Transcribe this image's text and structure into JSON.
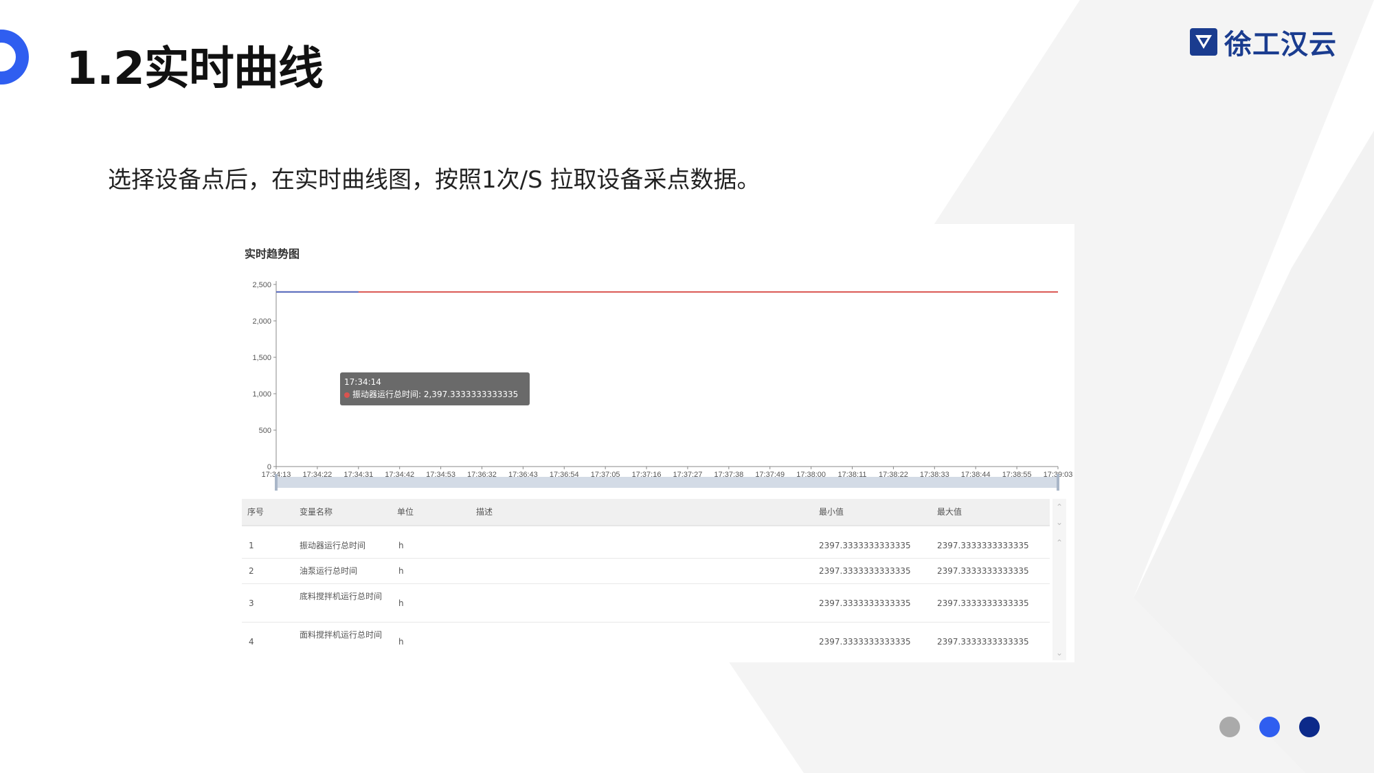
{
  "slide": {
    "title": "1.2实时曲线",
    "subtitle": "选择设备点后，在实时曲线图，按照1次/S 拉取设备采点数据。",
    "logo_text": "徐工汉云"
  },
  "colors": {
    "accent": "#2f5ef0",
    "logo": "#1a3c8f",
    "dot_gray": "#aaaaaa",
    "dot_blue": "#2f5ef0",
    "dot_navy": "#0c2a8a",
    "line_red": "#d9534f",
    "line_blue": "#5470c6"
  },
  "icons": [
    "xcmg-logo-icon",
    "chevron-up-icon",
    "chevron-down-icon"
  ],
  "chart_data": {
    "type": "line",
    "title": "实时趋势图",
    "x": [
      "17:34:13",
      "17:34:22",
      "17:34:31",
      "17:34:42",
      "17:34:53",
      "17:36:32",
      "17:36:43",
      "17:36:54",
      "17:37:05",
      "17:37:16",
      "17:37:27",
      "17:37:38",
      "17:37:49",
      "17:38:00",
      "17:38:11",
      "17:38:22",
      "17:38:33",
      "17:38:44",
      "17:38:55",
      "17:39:03"
    ],
    "series": [
      {
        "name": "振动器运行总时间",
        "values": [
          2397.3333333333335,
          2397.3333333333335,
          2397.3333333333335,
          2397.3333333333335,
          2397.3333333333335,
          2397.3333333333335,
          2397.3333333333335,
          2397.3333333333335,
          2397.3333333333335,
          2397.3333333333335,
          2397.3333333333335,
          2397.3333333333335,
          2397.3333333333335,
          2397.3333333333335,
          2397.3333333333335,
          2397.3333333333335,
          2397.3333333333335,
          2397.3333333333335,
          2397.3333333333335,
          2397.3333333333335
        ]
      }
    ],
    "yticks": [
      "0",
      "500",
      "1,000",
      "1,500",
      "2,000",
      "2,500"
    ],
    "ylim": [
      0,
      2500
    ],
    "grid": false,
    "tooltip": {
      "time": "17:34:14",
      "label": "振动器运行总时间: 2,397.3333333333335"
    }
  },
  "table": {
    "headers": {
      "index": "序号",
      "name": "变量名称",
      "unit": "单位",
      "desc": "描述",
      "min": "最小值",
      "max": "最大值"
    },
    "rows": [
      {
        "index": "1",
        "name": "振动器运行总时间",
        "unit": "h",
        "min": "2397.3333333333335",
        "max": "2397.3333333333335"
      },
      {
        "index": "2",
        "name": "油泵运行总时间",
        "unit": "h",
        "min": "2397.3333333333335",
        "max": "2397.3333333333335"
      },
      {
        "index": "3",
        "name": "底料搅拌机运行总时间",
        "unit": "h",
        "min": "2397.3333333333335",
        "max": "2397.3333333333335"
      },
      {
        "index": "4",
        "name": "面料搅拌机运行总时间",
        "unit": "h",
        "min": "2397.3333333333335",
        "max": "2397.3333333333335"
      }
    ]
  }
}
